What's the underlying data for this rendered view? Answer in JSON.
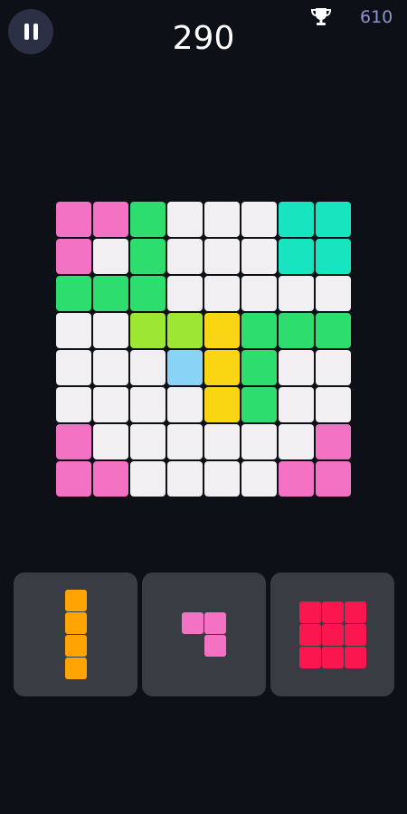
{
  "header": {
    "score": "290",
    "best_score": "610",
    "pause_icon": "pause-icon",
    "trophy_icon": "trophy-icon"
  },
  "colors": {
    "pink": "#f472c4",
    "green": "#2ddd6d",
    "teal": "#18e4c0",
    "white": "#f1eff2",
    "lime": "#9de733",
    "yellow": "#fad514",
    "blue": "#88d3f6",
    "orange": "#ffa402",
    "red": "#fc1650"
  },
  "board": {
    "size": 8,
    "cells": [
      [
        "pink",
        "pink",
        "green",
        "white",
        "white",
        "white",
        "teal",
        "teal"
      ],
      [
        "pink",
        "white",
        "green",
        "white",
        "white",
        "white",
        "teal",
        "teal"
      ],
      [
        "green",
        "green",
        "green",
        "white",
        "white",
        "white",
        "white",
        "white"
      ],
      [
        "white",
        "white",
        "lime",
        "lime",
        "yellow",
        "green",
        "green",
        "green"
      ],
      [
        "white",
        "white",
        "white",
        "blue",
        "yellow",
        "green",
        "white",
        "white"
      ],
      [
        "white",
        "white",
        "white",
        "white",
        "yellow",
        "green",
        "white",
        "white"
      ],
      [
        "pink",
        "white",
        "white",
        "white",
        "white",
        "white",
        "white",
        "pink"
      ],
      [
        "pink",
        "pink",
        "white",
        "white",
        "white",
        "white",
        "pink",
        "pink"
      ]
    ]
  },
  "pieces": [
    {
      "color": "orange",
      "cells": [
        [
          0,
          0
        ],
        [
          1,
          0
        ],
        [
          2,
          0
        ],
        [
          3,
          0
        ]
      ]
    },
    {
      "color": "pink",
      "cells": [
        [
          0,
          0
        ],
        [
          0,
          1
        ],
        [
          1,
          1
        ]
      ]
    },
    {
      "color": "red",
      "cells": [
        [
          0,
          0
        ],
        [
          0,
          1
        ],
        [
          0,
          2
        ],
        [
          1,
          0
        ],
        [
          1,
          1
        ],
        [
          1,
          2
        ],
        [
          2,
          0
        ],
        [
          2,
          1
        ],
        [
          2,
          2
        ]
      ]
    }
  ]
}
